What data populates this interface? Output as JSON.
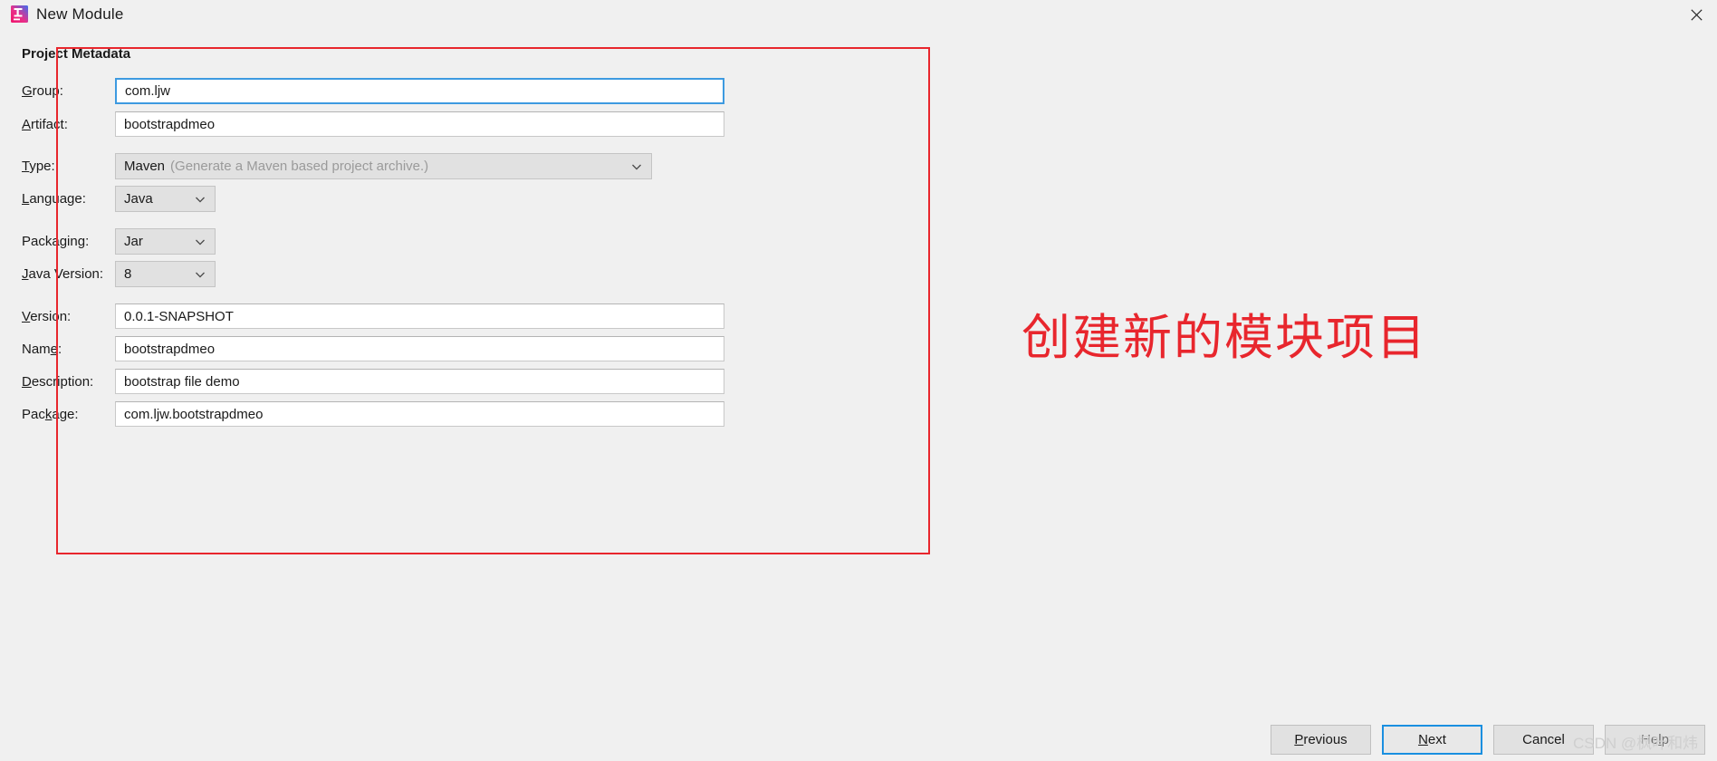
{
  "window": {
    "title": "New Module",
    "icon": "intellij-idea-icon",
    "close_icon": "close-icon"
  },
  "form": {
    "section_title": "Project Metadata",
    "fields": [
      {
        "label_pre": "",
        "label_mn": "G",
        "label_post": "roup:",
        "value": "com.ljw",
        "kind": "text",
        "focused": true
      },
      {
        "label_pre": "",
        "label_mn": "A",
        "label_post": "rtifact:",
        "value": "bootstrapdmeo",
        "kind": "text",
        "focused": false
      },
      {
        "label_pre": "",
        "label_mn": "T",
        "label_post": "ype:",
        "value": "Maven",
        "hint": "(Generate a Maven based project archive.)",
        "kind": "combo-wide"
      },
      {
        "label_pre": "",
        "label_mn": "L",
        "label_post": "anguage:",
        "value": "Java",
        "kind": "combo-small"
      },
      {
        "label_pre": "Packa",
        "label_mn": "g",
        "label_post": "ing:",
        "value": "Jar",
        "kind": "combo-small"
      },
      {
        "label_pre": "",
        "label_mn": "J",
        "label_post": "ava Version:",
        "value": "8",
        "kind": "combo-small"
      },
      {
        "label_pre": "",
        "label_mn": "V",
        "label_post": "ersion:",
        "value": "0.0.1-SNAPSHOT",
        "kind": "text",
        "focused": false
      },
      {
        "label_pre": "Nam",
        "label_mn": "e",
        "label_post": ":",
        "value": "bootstrapdmeo",
        "kind": "text",
        "focused": false
      },
      {
        "label_pre": "",
        "label_mn": "D",
        "label_post": "escription:",
        "value": "bootstrap file demo",
        "kind": "text",
        "focused": false
      },
      {
        "label_pre": "Pac",
        "label_mn": "k",
        "label_post": "age:",
        "value": "com.ljw.bootstrapdmeo",
        "kind": "text",
        "focused": false
      }
    ]
  },
  "annotation": {
    "text": "创建新的模块项目",
    "color": "#e8262d"
  },
  "footer": {
    "buttons": [
      {
        "pre": "",
        "mn": "P",
        "post": "revious",
        "state": "normal"
      },
      {
        "pre": "",
        "mn": "N",
        "post": "ext",
        "state": "default"
      },
      {
        "pre": "Cancel",
        "mn": "",
        "post": "",
        "state": "normal"
      },
      {
        "pre": "He",
        "mn": "l",
        "post": "p",
        "state": "disabled"
      }
    ]
  },
  "watermark": {
    "text": "CSDN @枫叶和炜"
  }
}
